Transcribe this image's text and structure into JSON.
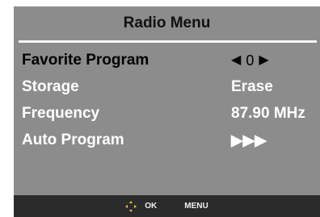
{
  "menu": {
    "title": "Radio Menu",
    "items": [
      {
        "label": "Favorite Program",
        "value": "0",
        "left_glyph": "◀",
        "right_glyph": "▶",
        "selected": true
      },
      {
        "label": "Storage",
        "value": "Erase"
      },
      {
        "label": "Frequency",
        "value": "87.90 MHz"
      },
      {
        "label": "Auto Program",
        "value": "▶▶▶"
      }
    ]
  },
  "footer": {
    "nav_icon": "four-way-arrows-icon",
    "ok_label": "OK",
    "menu_label": "MENU"
  },
  "colors": {
    "panel_bg": "#8c8c8c",
    "footer_bg": "#2b2b2b",
    "text_white": "#ffffff",
    "text_selected": "#000000",
    "nav_icon": "#e6c24a"
  }
}
